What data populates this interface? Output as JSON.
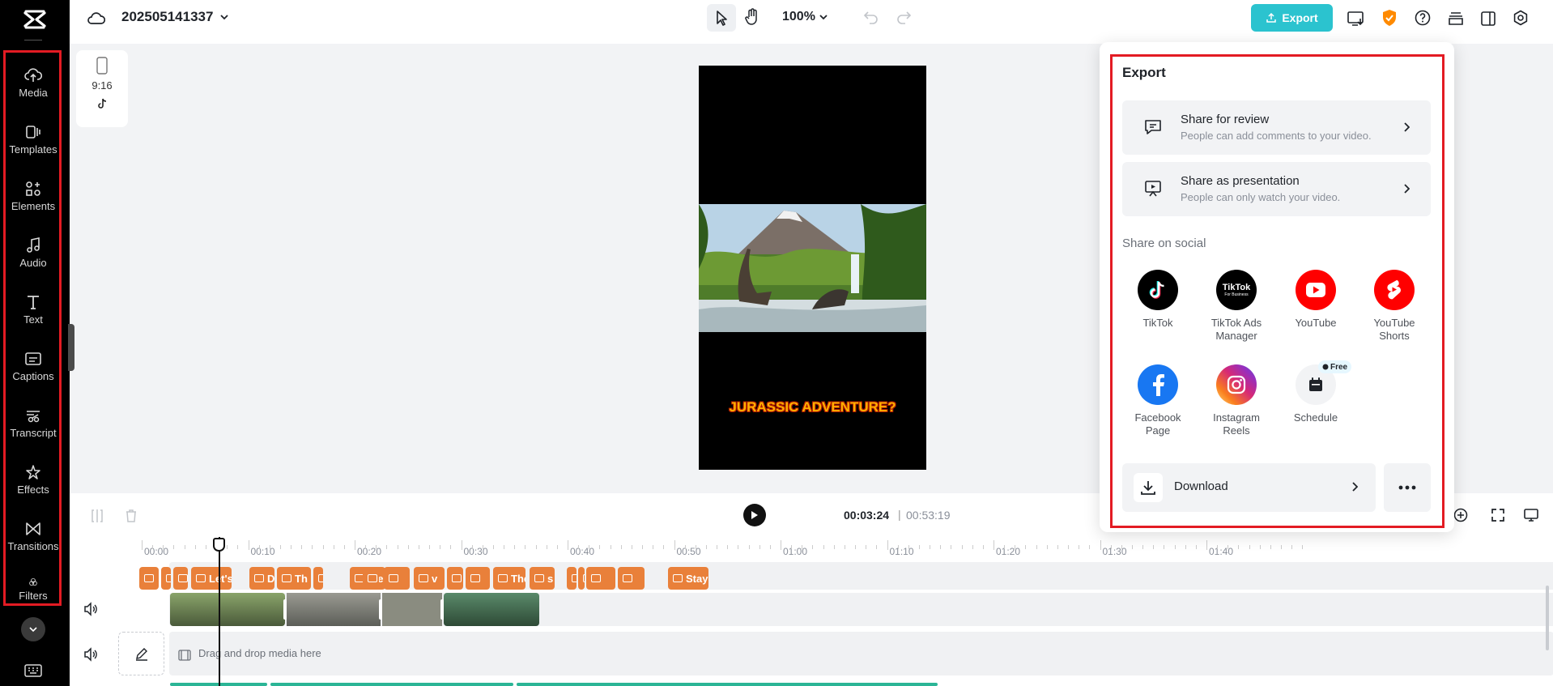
{
  "project": {
    "name": "202505141337"
  },
  "toolbar": {
    "zoom": "100%",
    "export_label": "Export"
  },
  "rail": {
    "items": [
      {
        "label": "Media",
        "icon": "cloud-upload-icon"
      },
      {
        "label": "Templates",
        "icon": "templates-icon"
      },
      {
        "label": "Elements",
        "icon": "elements-icon"
      },
      {
        "label": "Audio",
        "icon": "music-note-icon"
      },
      {
        "label": "Text",
        "icon": "text-icon"
      },
      {
        "label": "Captions",
        "icon": "captions-icon"
      },
      {
        "label": "Transcript",
        "icon": "transcript-icon"
      },
      {
        "label": "Effects",
        "icon": "effects-icon"
      },
      {
        "label": "Transitions",
        "icon": "transitions-icon"
      },
      {
        "label": "Filters",
        "icon": "filters-icon"
      }
    ]
  },
  "ratio": {
    "label": "9:16"
  },
  "preview": {
    "overlay_text": "JURASSIC ADVENTURE?"
  },
  "playback": {
    "current": "00:03:24",
    "separator": "|",
    "total": "00:53:19"
  },
  "ruler": [
    "00:00",
    "00:10",
    "00:20",
    "00:30",
    "00:40",
    "00:50",
    "01:00",
    "01:10",
    "01:20",
    "01:30",
    "01:40"
  ],
  "captions": [
    "",
    "",
    "",
    "Let's",
    "Did",
    "Th",
    "",
    "the",
    "",
    "",
    "v",
    "",
    "",
    "The",
    "s",
    "",
    "n",
    "",
    "",
    "Stay"
  ],
  "timeline": {
    "drop_text": "Drag and drop media here"
  },
  "export_panel": {
    "title": "Export",
    "share_review": {
      "title": "Share for review",
      "subtitle": "People can add comments to your video."
    },
    "share_presentation": {
      "title": "Share as presentation",
      "subtitle": "People can only watch your video."
    },
    "social_label": "Share on social",
    "social": [
      {
        "label": "TikTok",
        "color": "#000000"
      },
      {
        "label": "TikTok Ads Manager",
        "color": "#000000",
        "badge_text": "TikTok",
        "badge_sub": "For Business"
      },
      {
        "label": "YouTube",
        "color": "#ff0000"
      },
      {
        "label": "YouTube Shorts",
        "color": "#ff0000"
      },
      {
        "label": "Facebook Page",
        "color": "#1877f2"
      },
      {
        "label": "Instagram Reels",
        "color": "#e1306c"
      },
      {
        "label": "Schedule",
        "color": "#f2f3f5",
        "badge": "Free"
      }
    ],
    "download_label": "Download"
  },
  "colors": {
    "accent": "#2bc3cf",
    "highlight": "#e31b23",
    "caption": "#e9803a"
  }
}
